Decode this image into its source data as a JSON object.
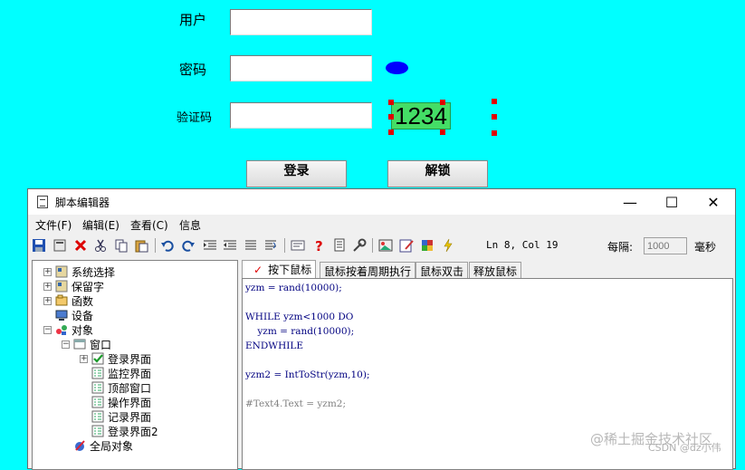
{
  "form": {
    "user_label": "用户",
    "password_label": "密码",
    "captcha_label": "验证码",
    "captcha_value": "1234",
    "login_button": "登录",
    "unlock_button": "解锁"
  },
  "editor_window": {
    "title": "脚本编辑器",
    "controls": {
      "minimize": "—",
      "maximize": "☐",
      "close": "✕"
    },
    "menu": [
      "文件(F)",
      "编辑(E)",
      "查看(C)",
      "信息"
    ],
    "status": "Ln 8, Col 19",
    "interval_label": "每隔:",
    "interval_value": "1000",
    "interval_unit": "毫秒"
  },
  "tree": [
    {
      "label": "系统选择",
      "icon": "module-icon",
      "expander": "+"
    },
    {
      "label": "保留字",
      "icon": "module-icon",
      "expander": "+"
    },
    {
      "label": "函数",
      "icon": "function-icon",
      "expander": "+"
    },
    {
      "label": "设备",
      "icon": "device-icon",
      "expander": ""
    },
    {
      "label": "对象",
      "icon": "objects-icon",
      "expander": "−"
    },
    {
      "label": "窗口",
      "icon": "window-icon",
      "expander": "−"
    },
    {
      "label": "登录界面",
      "icon": "checked-form-icon",
      "expander": "+"
    },
    {
      "label": "监控界面",
      "icon": "form-icon",
      "expander": ""
    },
    {
      "label": "顶部窗口",
      "icon": "form-icon",
      "expander": ""
    },
    {
      "label": "操作界面",
      "icon": "form-icon",
      "expander": ""
    },
    {
      "label": "记录界面",
      "icon": "form-icon",
      "expander": ""
    },
    {
      "label": "登录界面2",
      "icon": "form-icon",
      "expander": ""
    },
    {
      "label": "全局对象",
      "icon": "global-icon",
      "expander": ""
    }
  ],
  "tabs": [
    {
      "label": "按下鼠标",
      "active": true
    },
    {
      "label": "鼠标按着周期执行",
      "active": false
    },
    {
      "label": "鼠标双击",
      "active": false
    },
    {
      "label": "释放鼠标",
      "active": false
    }
  ],
  "code": [
    "yzm = rand(10000);",
    "",
    "WHILE yzm<1000 DO",
    "    yzm = rand(10000);",
    "ENDWHILE",
    "",
    "yzm2 = IntToStr(yzm,10);",
    "",
    "#Text4.Text = yzm2;"
  ],
  "watermark": {
    "main": "@稀土掘金技术社区",
    "sub": "CSDN @dz小伟"
  },
  "colors": {
    "background": "#00FFFF",
    "oval": "#0000FF",
    "captcha_bg": "#44DD66",
    "selection_handle": "#E00000"
  }
}
